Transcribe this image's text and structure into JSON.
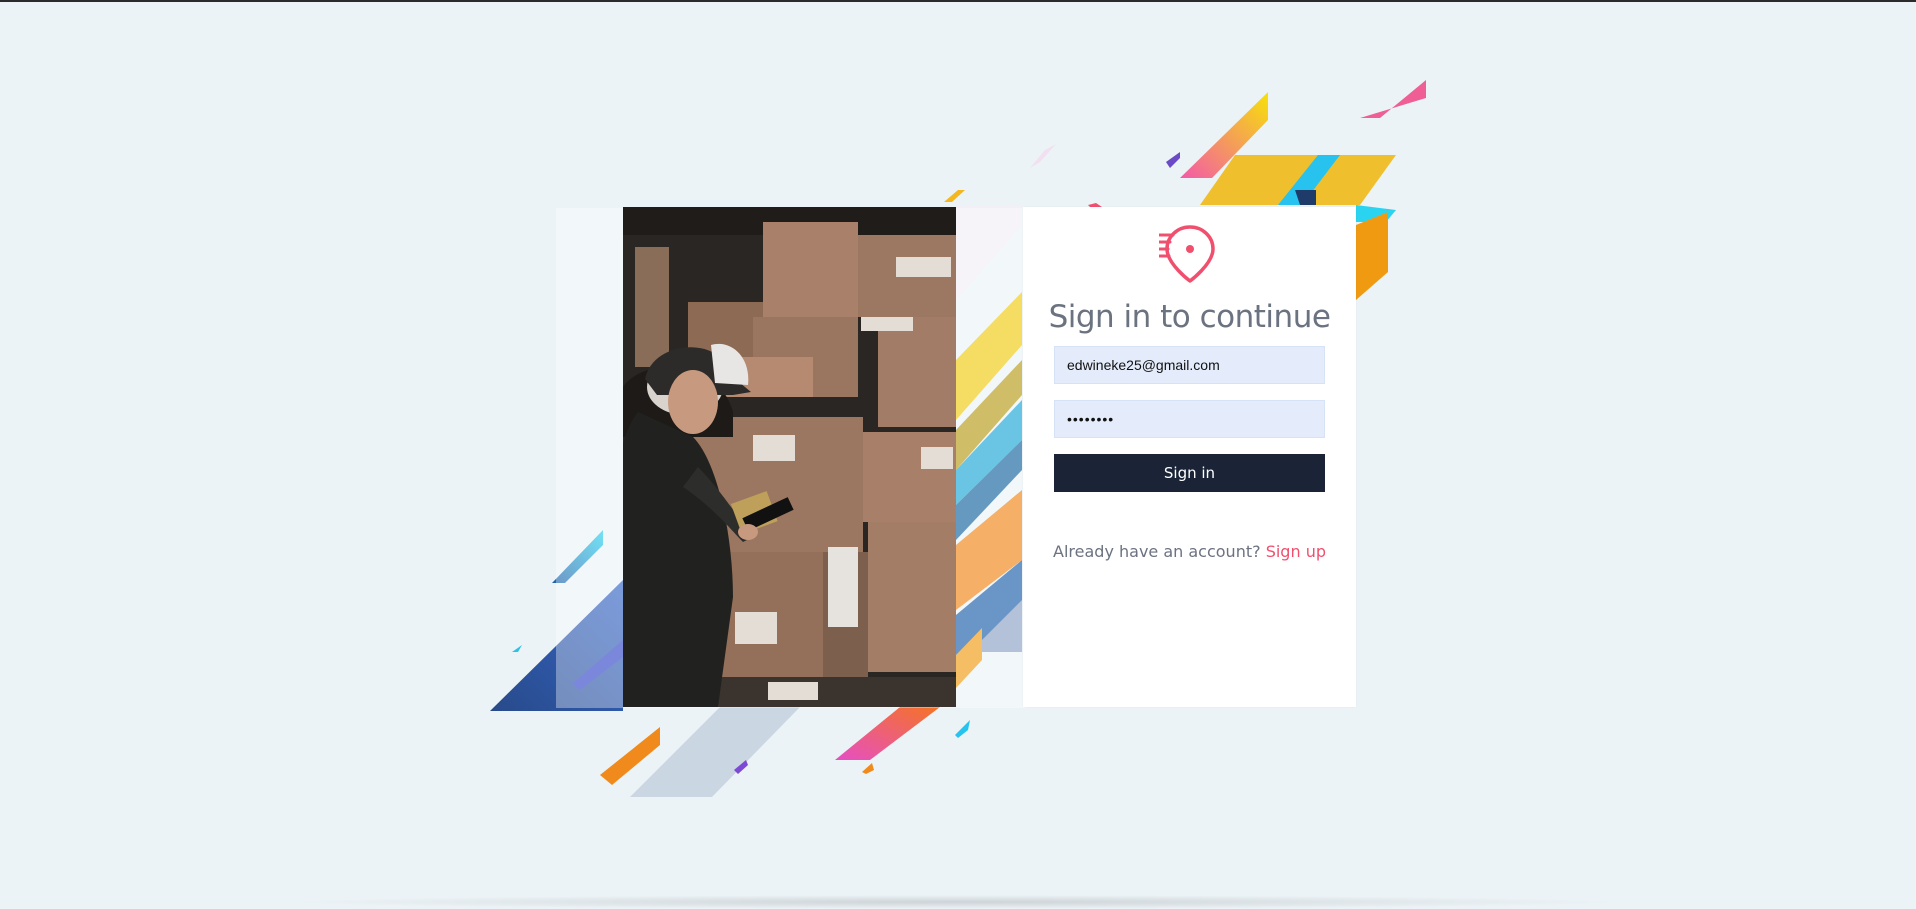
{
  "login": {
    "title": "Sign in to continue",
    "email_value": "edwineke25@gmail.com",
    "password_value": "••••••••",
    "sign_in_label": "Sign in",
    "account_prompt": "Already have an account?",
    "sign_up_label": "Sign up"
  },
  "icons": {
    "logo": "location-pin-icon"
  },
  "colors": {
    "accent": "#f0506e",
    "button": "#1a2436",
    "background": "#ecf3f6",
    "input": "#e4ecfb"
  }
}
